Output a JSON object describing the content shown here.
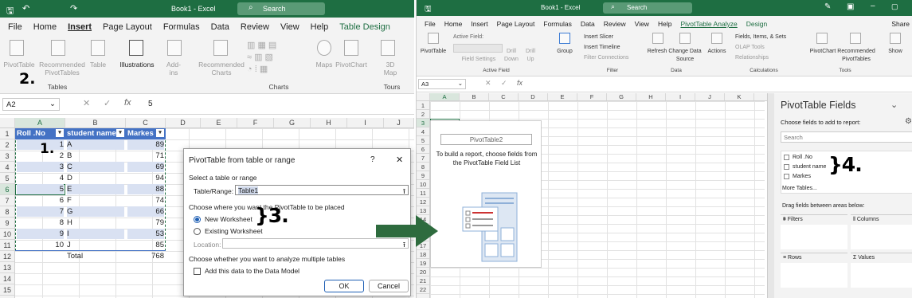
{
  "left": {
    "search": "Search",
    "book": "Book1 - Excel",
    "menu": [
      "File",
      "Home",
      "Insert",
      "Page Layout",
      "Formulas",
      "Data",
      "Review",
      "View",
      "Help",
      "Table Design"
    ],
    "ribbon": {
      "pivot": "PivotTable",
      "rec": "Recommended PivotTables",
      "table": "Table",
      "illus": "Illustrations",
      "addins": "Add-ins",
      "recch": "Recommended Charts",
      "maps": "Maps",
      "pivotchart": "PivotChart",
      "threed": "3D Map",
      "g_tables": "Tables",
      "g_charts": "Charts",
      "g_tours": "Tours"
    },
    "namebox": "A2",
    "formula": "5",
    "cols": [
      "A",
      "B",
      "C",
      "D",
      "E",
      "F",
      "G",
      "H",
      "I",
      "J"
    ],
    "rows": [
      "1",
      "2",
      "3",
      "4",
      "5",
      "6",
      "7",
      "8",
      "9",
      "10",
      "11",
      "12",
      "13",
      "14",
      "15"
    ],
    "headers": [
      "Roll .No",
      "student name",
      "Markes"
    ],
    "data": [
      [
        "1",
        "A",
        "89"
      ],
      [
        "2",
        "B",
        "71"
      ],
      [
        "3",
        "C",
        "69"
      ],
      [
        "4",
        "D",
        "94"
      ],
      [
        "5",
        "E",
        "88"
      ],
      [
        "6",
        "F",
        "74"
      ],
      [
        "7",
        "G",
        "66"
      ],
      [
        "8",
        "H",
        "79"
      ],
      [
        "9",
        "I",
        "53"
      ],
      [
        "10",
        "J",
        "85"
      ]
    ],
    "total_label": "Total",
    "total": "768"
  },
  "dialog": {
    "title": "PivotTable from table or range",
    "help": "?",
    "close": "✕",
    "s1": "Select a table or range",
    "range_label": "Table/Range:",
    "range_value": "Table1",
    "s2": "Choose where you want the PivotTable to be placed",
    "opt1": "New Worksheet",
    "opt2": "Existing Worksheet",
    "loc_label": "Location:",
    "s3": "Choose whether you want to analyze multiple tables",
    "chk": "Add this data to the Data Model",
    "ok": "OK",
    "cancel": "Cancel"
  },
  "annotations": {
    "a1": "1.",
    "a2": "2.",
    "a3": "}3.",
    "a4": "}4."
  },
  "right": {
    "book": "Book1 - Excel",
    "search": "Search",
    "menu": [
      "File",
      "Home",
      "Insert",
      "Page Layout",
      "Formulas",
      "Data",
      "Review",
      "View",
      "Help",
      "PivotTable Analyze",
      "Design"
    ],
    "share": "Share",
    "ribbon": {
      "pivot": "PivotTable",
      "active": "Active Field:",
      "field_settings": "Field Settings",
      "drill_down": "Drill Down",
      "drill_up": "Drill Up",
      "group": "Group",
      "slicer": "Insert Slicer",
      "timeline": "Insert Timeline",
      "filter_conn": "Filter Connections",
      "refresh": "Refresh",
      "change": "Change Data Source",
      "actions": "Actions",
      "fields": "Fields, Items, & Sets",
      "olap": "OLAP Tools",
      "rel": "Relationships",
      "pchart": "PivotChart",
      "rec": "Recommended PivotTables",
      "show": "Show",
      "g_active": "Active Field",
      "g_filter": "Filter",
      "g_data": "Data",
      "g_calc": "Calculations",
      "g_tools": "Tools"
    },
    "namebox": "A3",
    "cols": [
      "A",
      "B",
      "C",
      "D",
      "E",
      "F",
      "G",
      "H",
      "I",
      "J",
      "K"
    ],
    "rows": [
      "1",
      "2",
      "3",
      "4",
      "5",
      "6",
      "7",
      "8",
      "9",
      "10",
      "11",
      "12",
      "13",
      "14",
      "15",
      "16",
      "17",
      "18",
      "19",
      "20",
      "21",
      "22"
    ],
    "pivot_name": "PivotTable2",
    "pivot_msg": "To build a report, choose fields from the PivotTable Field List",
    "panel": {
      "title": "PivotTable Fields",
      "choose": "Choose fields to add to report:",
      "search": "Search",
      "fields": [
        "Roll .No",
        "student name",
        "Markes"
      ],
      "more": "More Tables...",
      "drag": "Drag fields between areas below:",
      "filters": "Filters",
      "columns": "Columns",
      "rows": "Rows",
      "values": "Values"
    }
  },
  "colors": {
    "excel_green": "#1e6e42",
    "arrow": "#2e6b3e",
    "table_blue": "#4472c4"
  }
}
